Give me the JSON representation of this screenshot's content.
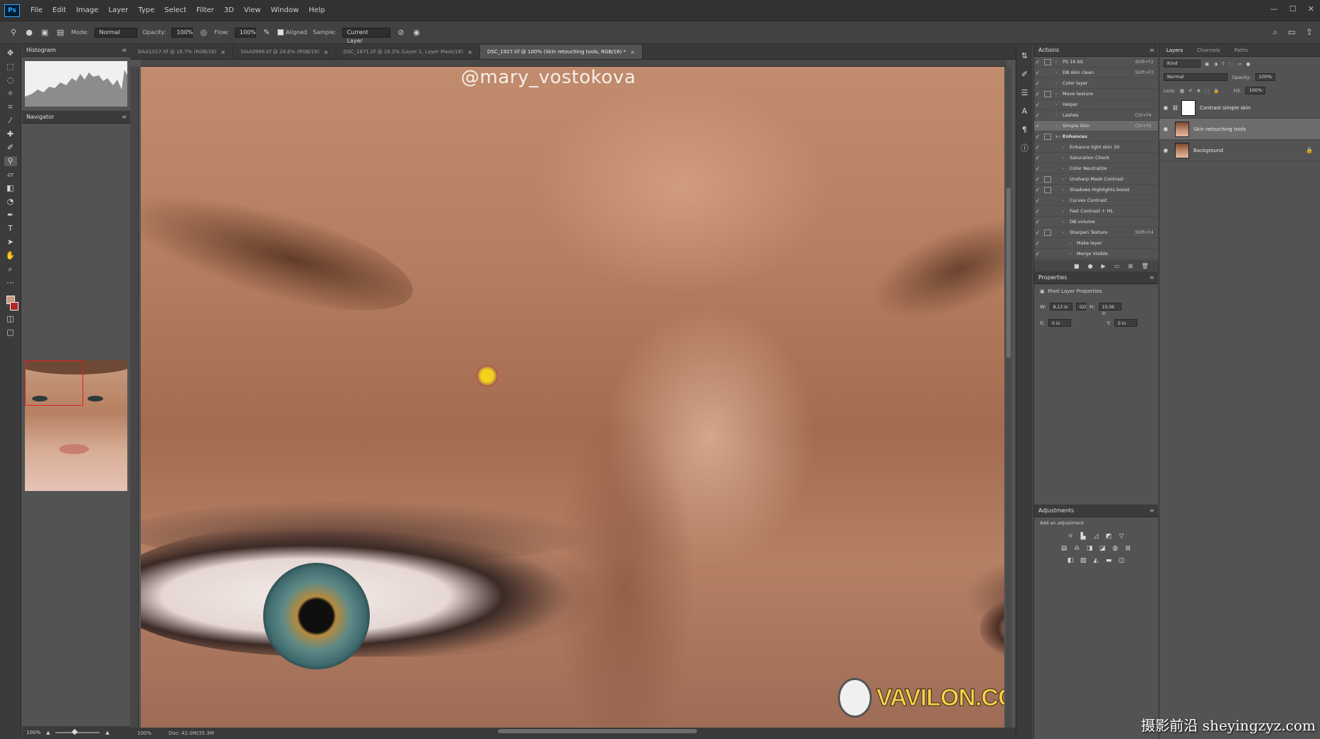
{
  "menubar": {
    "logo": "Ps",
    "items": [
      "File",
      "Edit",
      "Image",
      "Layer",
      "Type",
      "Select",
      "Filter",
      "3D",
      "View",
      "Window",
      "Help"
    ],
    "win_min": "—",
    "win_max": "☐",
    "win_close": "✕"
  },
  "options": {
    "mode_label": "Mode:",
    "mode_value": "Normal",
    "opacity_label": "Opacity:",
    "opacity_value": "100%",
    "flow_label": "Flow:",
    "flow_value": "100%",
    "aligned_label": "Aligned",
    "sample_label": "Sample:",
    "sample_value": "Current Layer"
  },
  "left": {
    "histogram_title": "Histogram",
    "navigator_title": "Navigator",
    "zoom_value": "100%"
  },
  "doctabs": [
    {
      "label": "3IAA1017.tif @ 16.7% (RGB/16)",
      "active": false
    },
    {
      "label": "3IAA0996.tif @ 24.6% (RGB/16)",
      "active": false
    },
    {
      "label": "DSC_1871.tif @ 16.2% (Layer 1, Layer Mask/16)",
      "active": false
    },
    {
      "label": "DSC_1927.tif @ 100% (Skin retouching tools, RGB/16) *",
      "active": true
    }
  ],
  "canvas": {
    "watermark": "@mary_vostokova",
    "logo_text": "VAVILON.CC"
  },
  "status": {
    "zoom": "100%",
    "doc": "Doc: 42.0M/35.3M"
  },
  "actions": {
    "title": "Actions",
    "rows": [
      {
        "name": "PS 16 bit",
        "key": "Shift+F2",
        "dlg": true,
        "indent": 0
      },
      {
        "name": "DB skin clean",
        "key": "Shift+F3",
        "dlg": false,
        "indent": 0
      },
      {
        "name": "Color layer",
        "key": "",
        "dlg": false,
        "indent": 0
      },
      {
        "name": "Move texture",
        "key": "",
        "dlg": true,
        "indent": 0
      },
      {
        "name": "Helper",
        "key": "",
        "dlg": false,
        "indent": 0
      },
      {
        "name": "Lashes",
        "key": "Ctrl+F4",
        "dlg": false,
        "indent": 0
      },
      {
        "name": "Simple Skin",
        "key": "Ctrl+F2",
        "dlg": false,
        "indent": 0,
        "selected": true
      },
      {
        "name": "Enhances",
        "key": "",
        "dlg": true,
        "indent": 0,
        "folder": true
      },
      {
        "name": "Enhance light skin 3X",
        "key": "",
        "dlg": false,
        "indent": 1
      },
      {
        "name": "Saturation Check",
        "key": "",
        "dlg": false,
        "indent": 1
      },
      {
        "name": "Color Neutralize",
        "key": "",
        "dlg": false,
        "indent": 1
      },
      {
        "name": "Unsharp Mask Contrast",
        "key": "",
        "dlg": true,
        "indent": 1
      },
      {
        "name": "Shadows Highlights boost",
        "key": "",
        "dlg": true,
        "indent": 1
      },
      {
        "name": "Curves Contrast",
        "key": "",
        "dlg": false,
        "indent": 1
      },
      {
        "name": "Fast Contrast + HL",
        "key": "",
        "dlg": false,
        "indent": 1
      },
      {
        "name": "DB volume",
        "key": "",
        "dlg": false,
        "indent": 1
      },
      {
        "name": "Sharpen Texture",
        "key": "Shift+F4",
        "dlg": true,
        "indent": 1
      },
      {
        "name": "Make layer",
        "key": "",
        "dlg": false,
        "indent": 2
      },
      {
        "name": "Merge Visible",
        "key": "",
        "dlg": false,
        "indent": 2
      }
    ]
  },
  "properties": {
    "title": "Properties",
    "subtitle": "Pixel Layer Properties",
    "w_label": "W:",
    "w_value": "8,13 in",
    "h_label": "H:",
    "h_value": "10,36 in",
    "link_label": "GO",
    "x_label": "X:",
    "x_value": "0 in",
    "y_label": "Y:",
    "y_value": "0 in"
  },
  "adjustments": {
    "title": "Adjustments",
    "subtitle": "Add an adjustment"
  },
  "layers": {
    "tabs": [
      "Layers",
      "Channels",
      "Paths"
    ],
    "kind_label": "Kind",
    "blend_value": "Normal",
    "opacity_label": "Opacity:",
    "opacity_value": "100%",
    "lock_label": "Lock:",
    "fill_label": "Fill:",
    "fill_value": "100%",
    "items": [
      {
        "name": "Contrast simple skin",
        "thumb": "white",
        "selected": false,
        "lock": false
      },
      {
        "name": "Skin retouching tools",
        "thumb": "face",
        "selected": true,
        "lock": false
      },
      {
        "name": "Background",
        "thumb": "face",
        "selected": false,
        "lock": true
      }
    ]
  },
  "site_mark": "摄影前沿 sheyingzyz.com"
}
